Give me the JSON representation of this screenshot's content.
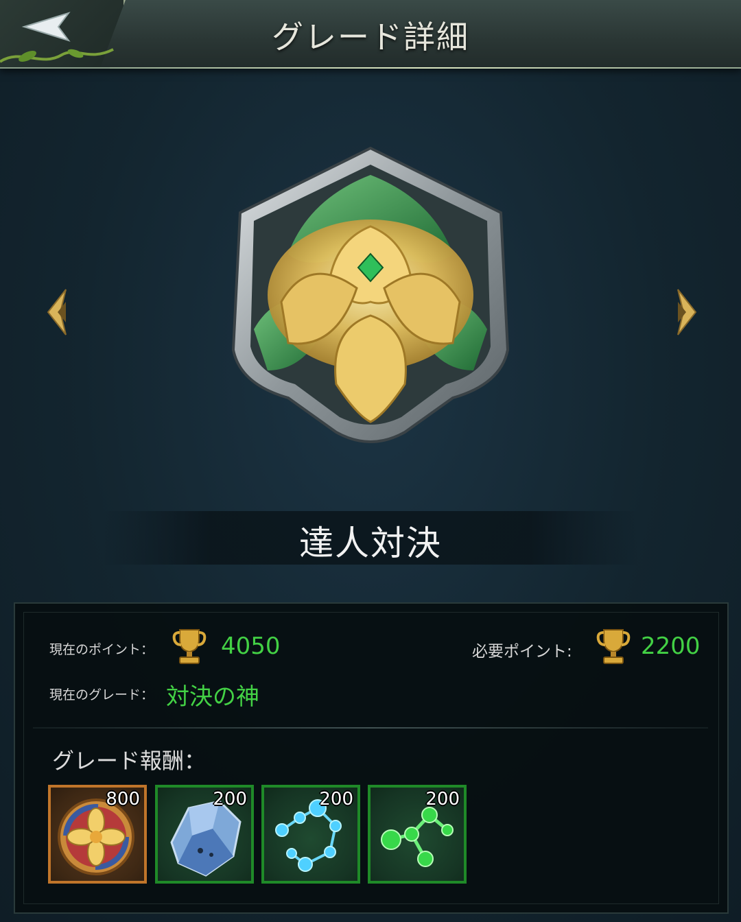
{
  "header": {
    "title": "グレード詳細"
  },
  "grade": {
    "name": "達人対決"
  },
  "stats": {
    "current_points_label": "現在のポイント：",
    "current_points_value": "4050",
    "required_points_label": "必要ポイント:",
    "required_points_value": "2200",
    "current_grade_label": "現在のグレード：",
    "current_grade_value": "対決の神"
  },
  "rewards": {
    "title": "グレード報酬：",
    "items": [
      {
        "icon": "gold-flower-medal-icon",
        "count": "800"
      },
      {
        "icon": "blue-crystal-icon",
        "count": "200"
      },
      {
        "icon": "blue-molecule-icon",
        "count": "200"
      },
      {
        "icon": "green-molecule-icon",
        "count": "200"
      }
    ]
  },
  "colors": {
    "accent_green": "#43d145",
    "reward_border_green": "#1f8a28",
    "reward_border_gold": "#c0752a"
  }
}
